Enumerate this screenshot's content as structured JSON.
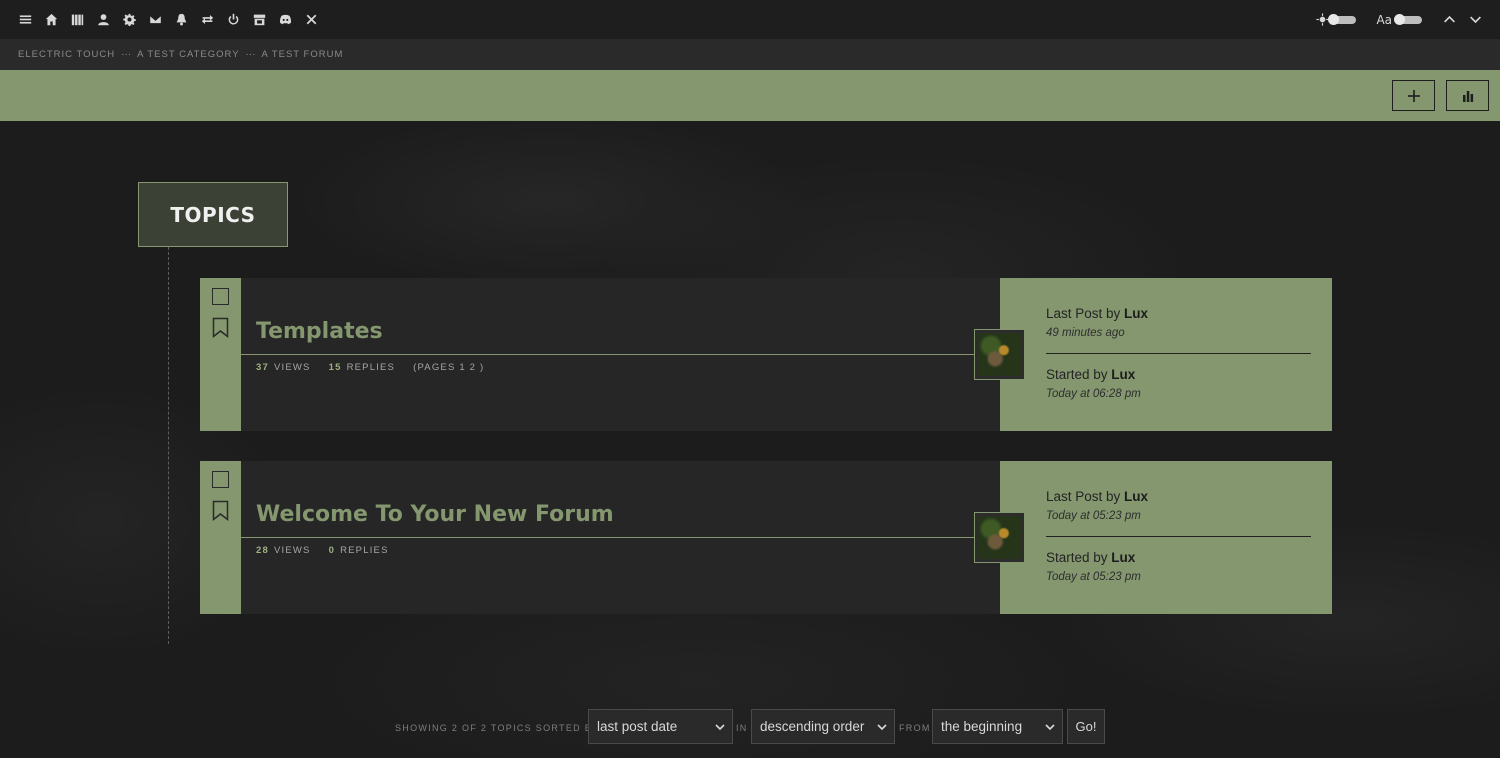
{
  "toolbar": {
    "icons": [
      "menu-icon",
      "home-icon",
      "library-icon",
      "user-icon",
      "gear-icon",
      "mail-icon",
      "bell-icon",
      "swap-icon",
      "power-icon",
      "store-icon",
      "discord-icon",
      "tools-icon"
    ],
    "theme_toggle_icon": "sun-icon",
    "font_toggle_label": "Aa",
    "chevron_up": "chevron-up-icon",
    "chevron_down": "chevron-down-icon"
  },
  "breadcrumb": {
    "items": [
      "ELECTRIC TOUCH",
      "A TEST CATEGORY",
      "A TEST FORUM"
    ],
    "separator": "···"
  },
  "header_band": {
    "new_topic_icon": "plus-icon",
    "stats_icon": "bar-chart-icon"
  },
  "section_title": "TOPICS",
  "topics": [
    {
      "title": "Templates",
      "views": "37",
      "views_label": "VIEWS",
      "replies": "15",
      "replies_label": "REPLIES",
      "pages": "(PAGES 1 2 )",
      "last_post_prefix": "Last Post by ",
      "last_post_user": "Lux",
      "last_post_time": "49 minutes ago",
      "started_prefix": "Started by ",
      "started_user": "Lux",
      "started_time": "Today at 06:28 pm"
    },
    {
      "title": "Welcome To Your New Forum",
      "views": "28",
      "views_label": "VIEWS",
      "replies": "0",
      "replies_label": "REPLIES",
      "pages": "",
      "last_post_prefix": "Last Post by ",
      "last_post_user": "Lux",
      "last_post_time": "Today at 05:23 pm",
      "started_prefix": "Started by ",
      "started_user": "Lux",
      "started_time": "Today at 05:23 pm"
    }
  ],
  "sort": {
    "showing_text": "SHOWING 2 OF 2 TOPICS SORTED BY",
    "in_text": "IN",
    "from_text": "FROM",
    "sort_by_value": "last post date",
    "order_value": "descending order",
    "from_value": "the beginning",
    "go_label": "Go!"
  },
  "colors": {
    "accent": "#84976f",
    "background": "#1c1c1c",
    "card": "#262626"
  }
}
